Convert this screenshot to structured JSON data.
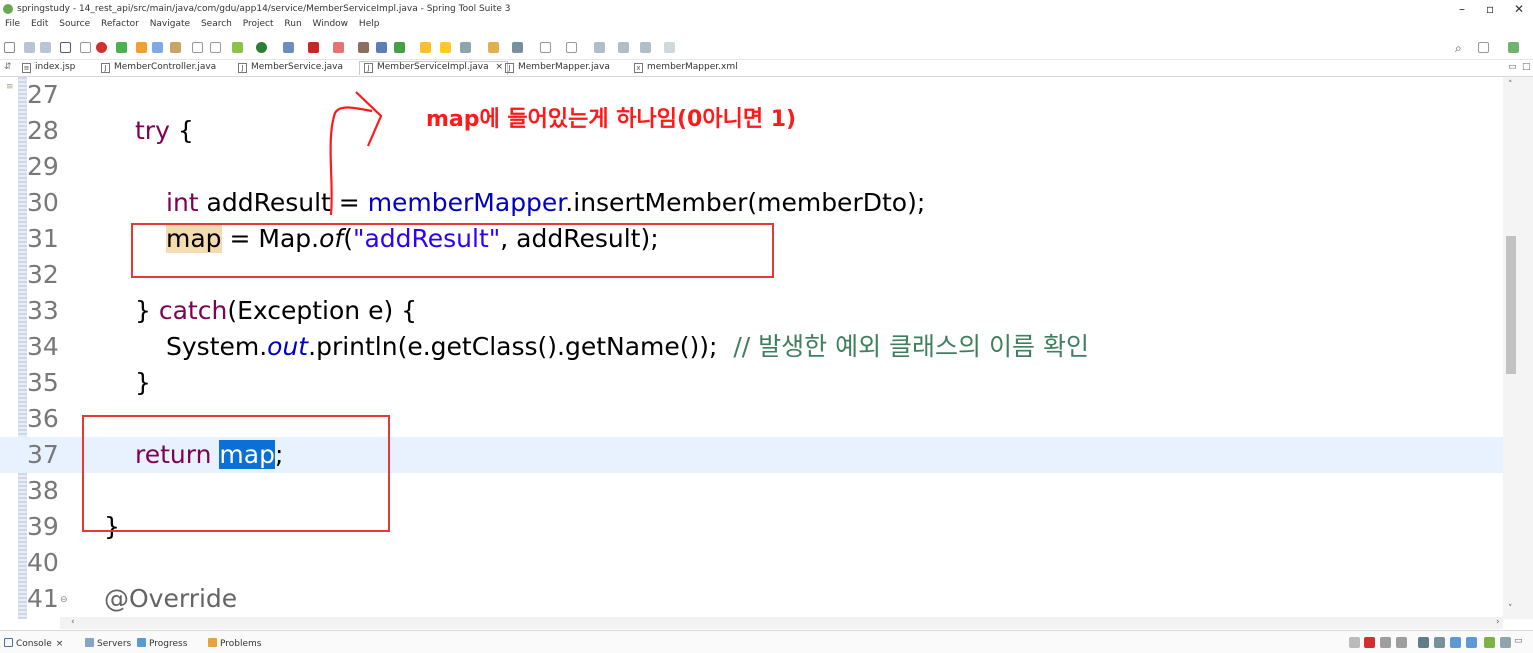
{
  "window": {
    "title": "springstudy - 14_rest_api/src/main/java/com/gdu/app14/service/MemberServiceImpl.java - Spring Tool Suite 3",
    "minimize": "–",
    "maximize": "▫",
    "close": "✕"
  },
  "menu": [
    "File",
    "Edit",
    "Source",
    "Refactor",
    "Navigate",
    "Search",
    "Project",
    "Run",
    "Window",
    "Help"
  ],
  "tabs": [
    {
      "label": "index.jsp",
      "icon": "jsp-file-icon"
    },
    {
      "label": "MemberController.java",
      "icon": "java-file-icon"
    },
    {
      "label": "MemberService.java",
      "icon": "java-file-icon"
    },
    {
      "label": "MemberServiceImpl.java",
      "icon": "java-file-icon",
      "active": true,
      "close": "×"
    },
    {
      "label": "MemberMapper.java",
      "icon": "java-file-icon"
    },
    {
      "label": "memberMapper.xml",
      "icon": "xml-file-icon"
    }
  ],
  "code": {
    "lines": [
      {
        "n": "27"
      },
      {
        "n": "28",
        "try": "try",
        "brace": " {"
      },
      {
        "n": "29"
      },
      {
        "n": "30",
        "int": "int",
        "var": " addResult = ",
        "field": "memberMapper",
        "rest": ".insertMember(memberDto);"
      },
      {
        "n": "31",
        "map": "map",
        "eq": " = Map.",
        "of": "of",
        "open": "(",
        "str": "\"addResult\"",
        "rest": ", addResult);"
      },
      {
        "n": "32"
      },
      {
        "n": "33",
        "close": "} ",
        "catch": "catch",
        "rest": "(Exception e) {"
      },
      {
        "n": "34",
        "sys": "System.",
        "out": "out",
        "rest": ".println(e.getClass().getName());  ",
        "comment": "// 발생한 예외 클래스의 이름 확인"
      },
      {
        "n": "35",
        "brace": "}"
      },
      {
        "n": "36"
      },
      {
        "n": "37",
        "ret": "return",
        "sp": " ",
        "map": "map",
        "semi": ";"
      },
      {
        "n": "38"
      },
      {
        "n": "39",
        "brace": "}"
      },
      {
        "n": "40"
      },
      {
        "n": "41",
        "fold": "⊖",
        "annotation": "@Override"
      }
    ]
  },
  "annotation_note": "map에 들어있는게 하나임(0아니면 1)",
  "bottom_tabs": [
    "Console",
    "Servers",
    "Progress",
    "Problems"
  ],
  "colors": {
    "keyword": "#7f0055",
    "field": "#0000c0",
    "string": "#2a00ff",
    "comment": "#3f7f5f",
    "annotation_red": "#ff1a1a",
    "selection": "#0a6fd6"
  }
}
